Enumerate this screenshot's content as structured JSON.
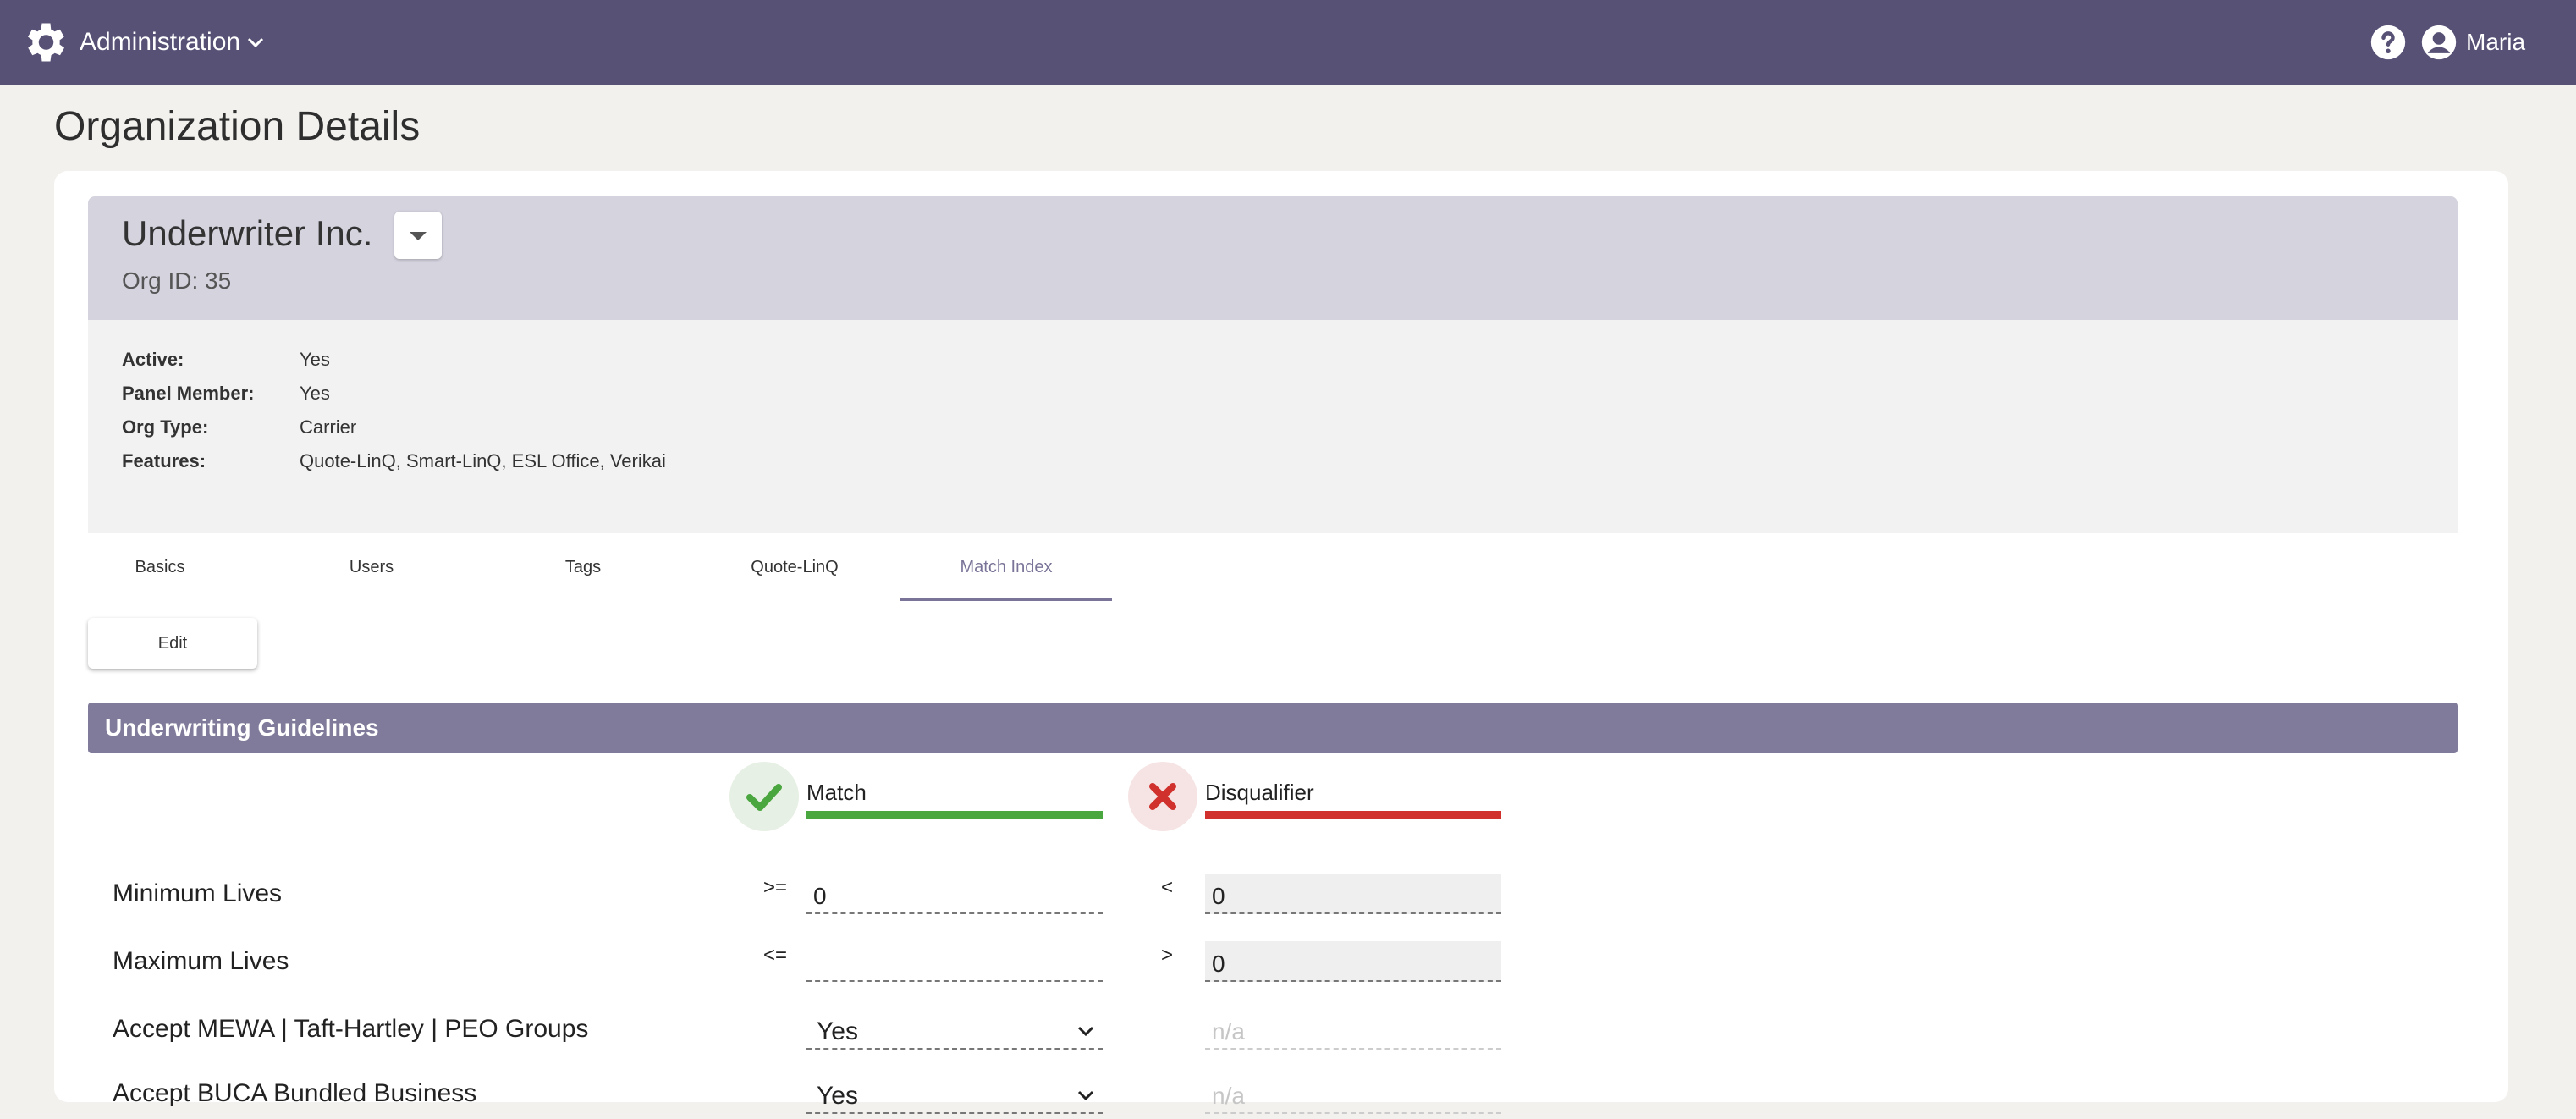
{
  "topbar": {
    "title": "Administration",
    "user": "Maria",
    "bg_color": "#585176",
    "icons": [
      "gear-icon",
      "chevron-down-icon",
      "help-icon",
      "user-avatar-icon"
    ]
  },
  "page": {
    "title": "Organization Details"
  },
  "org": {
    "name": "Underwriter Inc.",
    "id_text": "Org ID: 35",
    "details": [
      {
        "label": "Active:",
        "value": "Yes"
      },
      {
        "label": "Panel Member:",
        "value": "Yes"
      },
      {
        "label": "Org Type:",
        "value": "Carrier"
      },
      {
        "label": "Features:",
        "value": "Quote-LinQ, Smart-LinQ, ESL Office, Verikai"
      }
    ]
  },
  "tabs": [
    {
      "label": "Basics"
    },
    {
      "label": "Users"
    },
    {
      "label": "Tags"
    },
    {
      "label": "Quote-LinQ"
    },
    {
      "label": "Match Index",
      "active": true
    }
  ],
  "actions": {
    "edit_label": "Edit"
  },
  "guidelines": {
    "title": "Underwriting Guidelines",
    "match_label": "Match",
    "disqualifier_label": "Disqualifier",
    "match_color": "#4aa63f",
    "disqualifier_color": "#d0312d",
    "rows": [
      {
        "label": "Minimum Lives",
        "match_op": ">=",
        "match_value": "0",
        "dq_op": "<",
        "dq_value": "0"
      },
      {
        "label": "Maximum Lives",
        "match_op": "<=",
        "match_value": "",
        "dq_op": ">",
        "dq_value": "0"
      },
      {
        "label": "Accept MEWA | Taft-Hartley | PEO Groups",
        "match_value": "Yes",
        "dq_value": "n/a"
      },
      {
        "label": "Accept BUCA Bundled Business",
        "match_value": "Yes",
        "dq_value": "n/a"
      }
    ]
  }
}
